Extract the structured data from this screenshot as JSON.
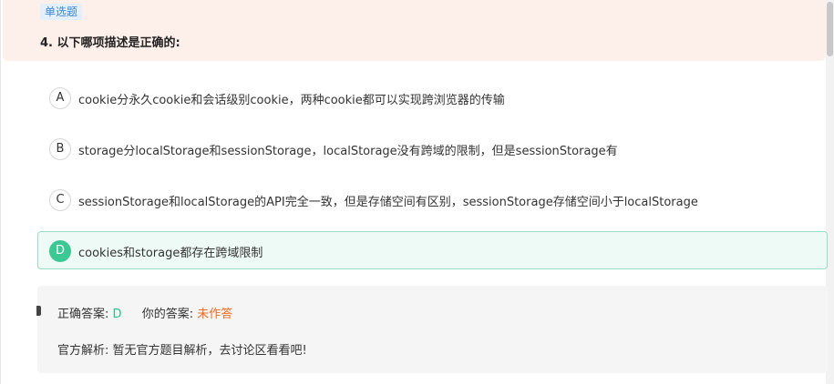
{
  "question": {
    "type_badge": "单选题",
    "title": "4. 以下哪项描述是正确的:"
  },
  "options": [
    {
      "letter": "A",
      "text": "cookie分永久cookie和会话级别cookie，两种cookie都可以实现跨浏览器的传输"
    },
    {
      "letter": "B",
      "text": "storage分localStorage和sessionStorage，localStorage没有跨域的限制，但是sessionStorage有"
    },
    {
      "letter": "C",
      "text": "sessionStorage和localStorage的API完全一致，但是存储空间有区别，sessionStorage存储空间小于localStorage"
    },
    {
      "letter": "D",
      "text": "cookies和storage都存在跨域限制"
    }
  ],
  "answer": {
    "correct_label": "正确答案:",
    "correct_value": "D",
    "yours_label": "你的答案:",
    "yours_value": "未作答",
    "analysis_label": "官方解析:",
    "analysis_text": "暂无官方题目解析，去讨论区看看吧!"
  },
  "colors": {
    "header_bg": "#fdf0ea",
    "badge_bg": "#e3f0fc",
    "badge_text": "#3a86d8",
    "correct_green": "#3cc795",
    "correct_bg": "#eefaf5",
    "unanswered_orange": "#f06a1e",
    "panel_bg": "#f5f5f5"
  }
}
